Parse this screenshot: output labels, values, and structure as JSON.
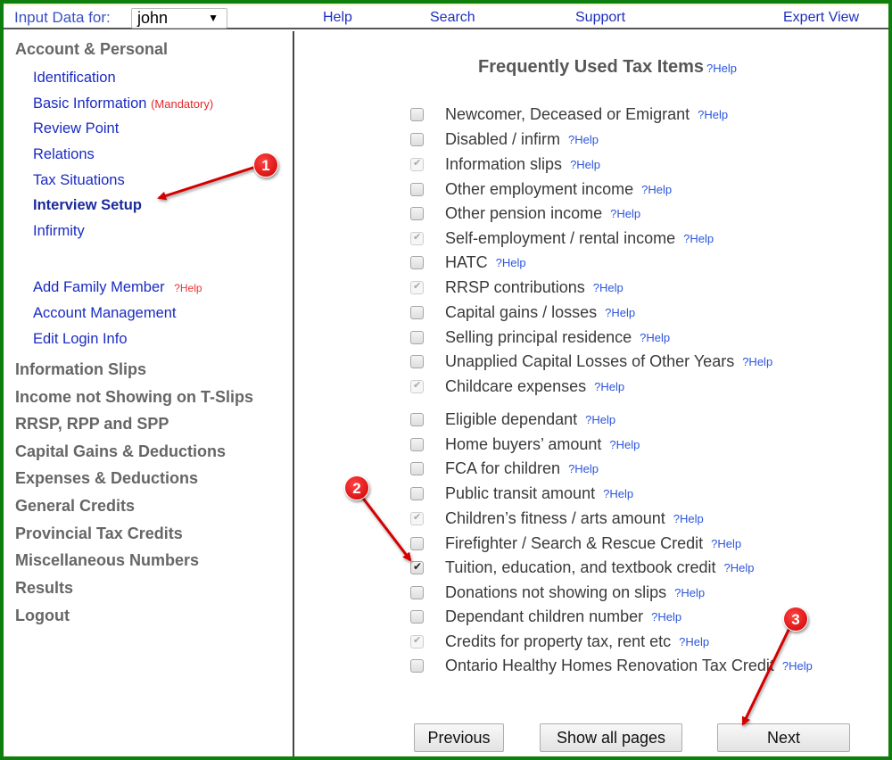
{
  "topbar": {
    "input_label": "Input Data for:",
    "selected_user": "john",
    "links": [
      "Help",
      "Search",
      "Support",
      "Expert View"
    ]
  },
  "sidebar": {
    "account_section": "Account & Personal",
    "account_items": [
      {
        "label": "Identification"
      },
      {
        "label": "Basic Information",
        "note": "(Mandatory)"
      },
      {
        "label": "Review Point"
      },
      {
        "label": "Relations"
      },
      {
        "label": "Tax Situations"
      },
      {
        "label": "Interview Setup",
        "active": true
      },
      {
        "label": "Infirmity"
      }
    ],
    "family_items": [
      {
        "label": "Add Family Member",
        "help": "?Help"
      },
      {
        "label": "Account Management"
      },
      {
        "label": "Edit Login Info"
      }
    ],
    "sections": [
      "Information Slips",
      "Income not Showing on T-Slips",
      "RRSP, RPP and SPP",
      "Capital Gains & Deductions",
      "Expenses & Deductions",
      "General Credits",
      "Provincial Tax Credits",
      "Miscellaneous Numbers",
      "Results",
      "Logout"
    ]
  },
  "main": {
    "title": "Frequently Used Tax Items",
    "title_help": "?Help",
    "help_label": "?Help",
    "items": [
      {
        "label": "Newcomer, Deceased or Emigrant",
        "state": "unchecked"
      },
      {
        "label": "Disabled / infirm",
        "state": "unchecked"
      },
      {
        "label": "Information slips",
        "state": "checked-disabled"
      },
      {
        "label": "Other employment income",
        "state": "unchecked"
      },
      {
        "label": "Other pension income",
        "state": "unchecked"
      },
      {
        "label": "Self-employment / rental income",
        "state": "checked-disabled"
      },
      {
        "label": "HATC",
        "state": "unchecked"
      },
      {
        "label": "RRSP contributions",
        "state": "checked-disabled"
      },
      {
        "label": "Capital gains / losses",
        "state": "unchecked"
      },
      {
        "label": "Selling principal residence",
        "state": "unchecked"
      },
      {
        "label": "Unapplied Capital Losses of Other Years",
        "state": "unchecked"
      },
      {
        "label": "Childcare expenses",
        "state": "checked-disabled"
      },
      {
        "label": "Eligible dependant",
        "state": "unchecked"
      },
      {
        "label": "Home buyers’ amount",
        "state": "unchecked"
      },
      {
        "label": "FCA for children",
        "state": "unchecked"
      },
      {
        "label": "Public transit amount",
        "state": "unchecked"
      },
      {
        "label": "Children’s fitness / arts amount",
        "state": "checked-disabled"
      },
      {
        "label": "Firefighter / Search & Rescue Credit",
        "state": "unchecked"
      },
      {
        "label": "Tuition, education, and textbook credit",
        "state": "checked"
      },
      {
        "label": "Donations not showing on slips",
        "state": "unchecked"
      },
      {
        "label": "Dependant children number",
        "state": "unchecked"
      },
      {
        "label": "Credits for property tax, rent etc",
        "state": "checked-disabled"
      },
      {
        "label": "Ontario Healthy Homes Renovation Tax Credit",
        "state": "unchecked"
      }
    ],
    "buttons": {
      "previous": "Previous",
      "show_all": "Show all pages",
      "next": "Next"
    }
  },
  "annotations": {
    "badges": [
      "1",
      "2",
      "3"
    ]
  },
  "colors": {
    "frame_border": "#0e7f0e",
    "link_blue": "#1a2bc2",
    "help_blue": "#2b55dd",
    "mandatory_red": "#e2282c",
    "section_gray": "#666666",
    "annotation_red": "#d40000"
  }
}
